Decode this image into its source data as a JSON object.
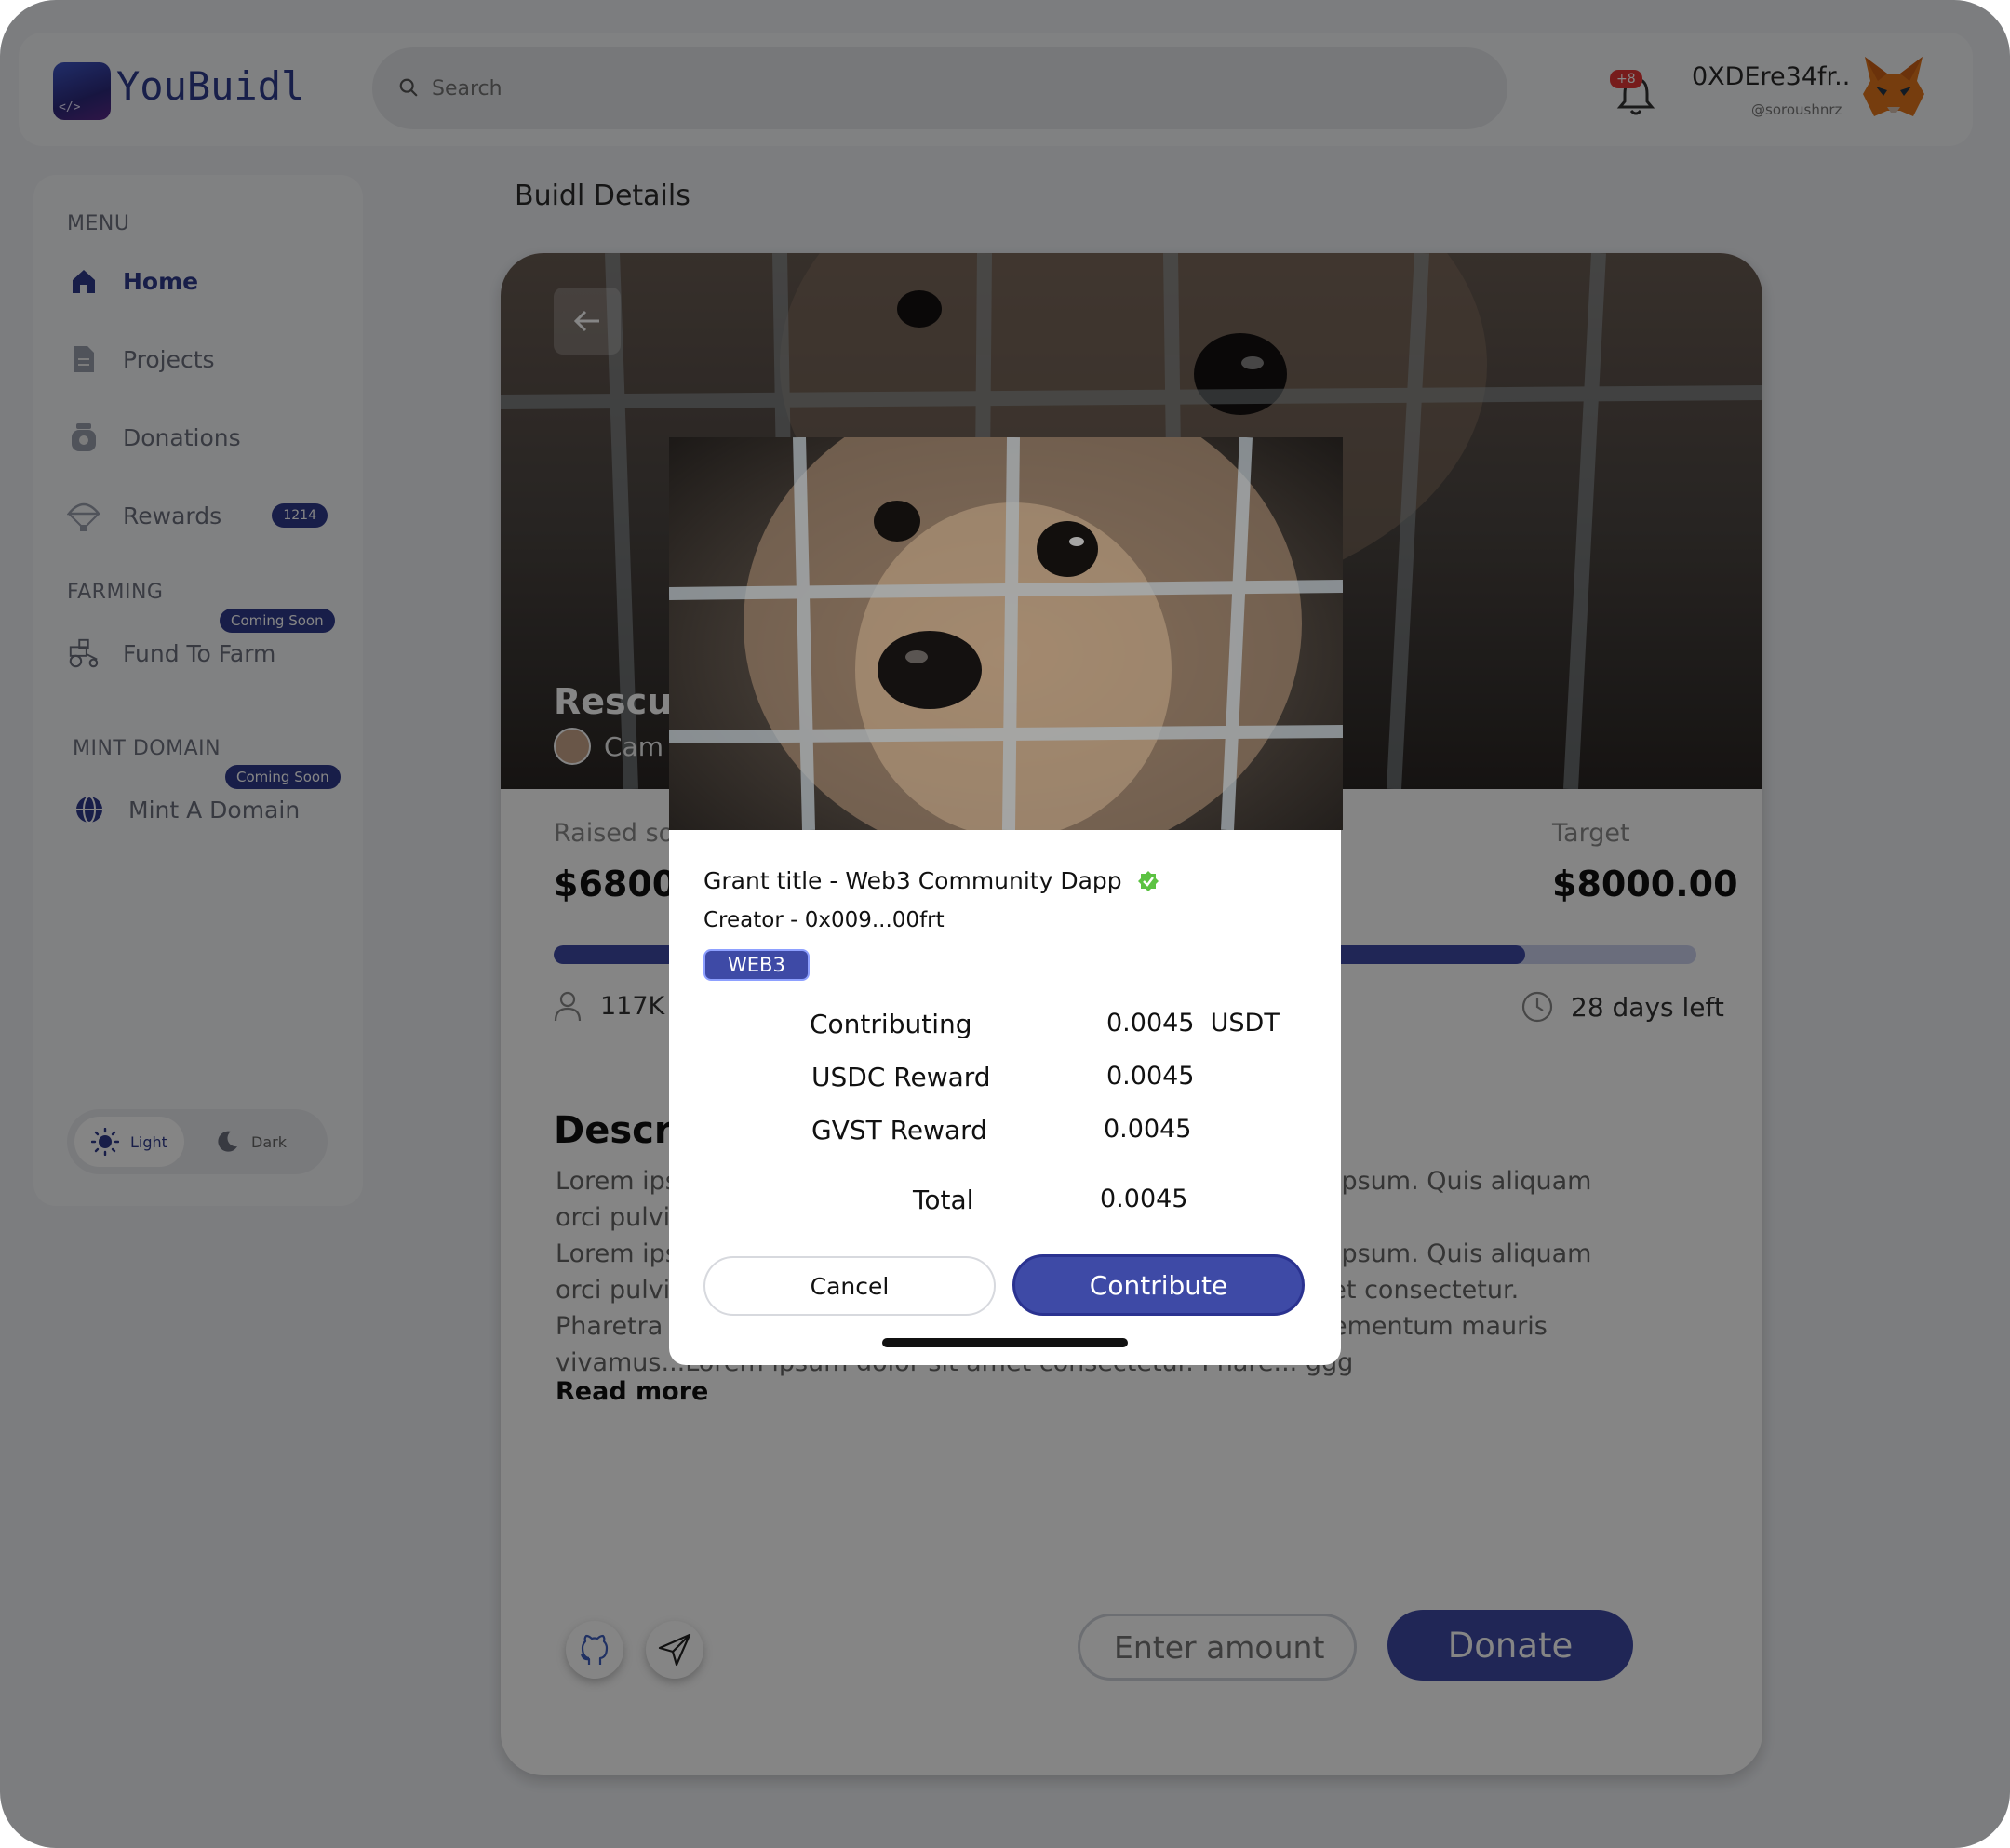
{
  "app": {
    "brand": "YouBuidl",
    "logo_glyph": "</>"
  },
  "search": {
    "placeholder": "Search"
  },
  "notifications": {
    "badge": "+8"
  },
  "user": {
    "name": "0XDEre34fr..",
    "handle": "@soroushnrz"
  },
  "sidebar": {
    "menu_title": "MENU",
    "items": [
      {
        "label": "Home",
        "icon": "home-icon",
        "active": true
      },
      {
        "label": "Projects",
        "icon": "document-icon"
      },
      {
        "label": "Donations",
        "icon": "donation-jar-icon"
      },
      {
        "label": "Rewards",
        "icon": "parachute-icon",
        "badge": "1214"
      }
    ],
    "farming_title": "FARMING",
    "farming_item": {
      "label": "Fund To Farm",
      "icon": "tractor-icon",
      "badge": "Coming Soon"
    },
    "mint_title": "MINT DOMAIN",
    "mint_item": {
      "label": "Mint A Domain",
      "icon": "globe-icon",
      "badge": "Coming Soon"
    },
    "theme": {
      "light": "Light",
      "dark": "Dark",
      "selected": "Light"
    }
  },
  "main": {
    "page_title": "Buidl Details",
    "hero_title": "Rescui",
    "hero_creator": "Cam",
    "raised_label": "Raised so",
    "raised_value": "$6800.",
    "target_label": "Target",
    "target_value": "$8000.00",
    "progress": 0.85,
    "backers": "117K",
    "days_left": "28 days left",
    "description_title": "Descri",
    "description_lines": [
      "Lorem ips                                                                         lacus ipsum. Quis aliquam",
      "orci pulvi",
      "Lorem ips                                                                         lacus ipsum. Quis aliquam",
      "orci pulvi                                                                         sit amet consectetur.",
      "Pharetra                                                                            eu elementum mauris",
      "vivamus...Lorem ipsum dolor sit amet consectetur. Phare... ggg"
    ],
    "read_more": "Read more",
    "amount_placeholder": "Enter amount",
    "donate_label": "Donate"
  },
  "modal": {
    "grant_title": "Grant title - Web3 Community Dapp",
    "creator": "Creator - 0x009...00frt",
    "tag": "WEB3",
    "rows": [
      {
        "label": "Contributing",
        "value": "0.0045  USDT"
      },
      {
        "label": "USDC Reward",
        "value": "0.0045"
      },
      {
        "label": "GVST Reward",
        "value": "0.0045"
      },
      {
        "label": "Total",
        "value": "0.0045"
      }
    ],
    "cancel_label": "Cancel",
    "contribute_label": "Contribute"
  },
  "colors": {
    "accent": "#3e4aa6",
    "badge_red": "#e53636",
    "verified_green": "#5cc242"
  }
}
